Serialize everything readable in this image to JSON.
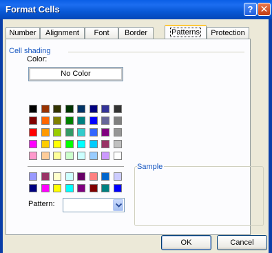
{
  "window": {
    "title": "Format Cells",
    "help_glyph": "?",
    "close_glyph": "✕"
  },
  "tabs": [
    {
      "label": "Number"
    },
    {
      "label": "Alignment"
    },
    {
      "label": "Font"
    },
    {
      "label": "Border"
    },
    {
      "label": "Patterns",
      "active": true
    },
    {
      "label": "Protection"
    }
  ],
  "cell_shading": {
    "group_title": "Cell shading",
    "color_label": "Color:",
    "no_color_label": "No Color",
    "palette_main": [
      [
        "#000000",
        "#993300",
        "#333300",
        "#003300",
        "#003366",
        "#000080",
        "#333399",
        "#333333"
      ],
      [
        "#800000",
        "#ff6600",
        "#808000",
        "#008000",
        "#008080",
        "#0000ff",
        "#666699",
        "#808080"
      ],
      [
        "#ff0000",
        "#ff9900",
        "#99cc00",
        "#339966",
        "#33cccc",
        "#3366ff",
        "#800080",
        "#969696"
      ],
      [
        "#ff00ff",
        "#ffcc00",
        "#ffff00",
        "#00ff00",
        "#00ffff",
        "#00ccff",
        "#993366",
        "#c0c0c0"
      ],
      [
        "#ff99cc",
        "#ffcc99",
        "#ffff99",
        "#ccffcc",
        "#ccffff",
        "#99ccff",
        "#cc99ff",
        "#ffffff"
      ]
    ],
    "palette_chart": [
      [
        "#9999ff",
        "#993366",
        "#ffffcc",
        "#ccffff",
        "#660066",
        "#ff8080",
        "#0066cc",
        "#ccccff"
      ],
      [
        "#000080",
        "#ff00ff",
        "#ffff00",
        "#00ffff",
        "#800080",
        "#800000",
        "#008080",
        "#0000ff"
      ]
    ],
    "sample_label": "Sample",
    "pattern_label": "Pattern:",
    "pattern_value": ""
  },
  "buttons": {
    "ok": "OK",
    "cancel": "Cancel"
  }
}
